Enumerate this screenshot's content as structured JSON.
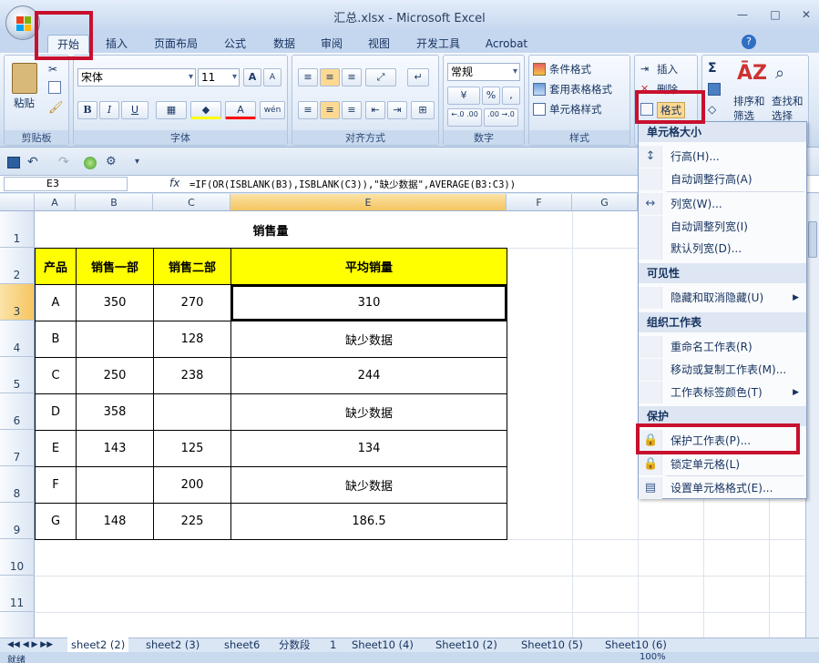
{
  "window": {
    "title": "汇总.xlsx - Microsoft Excel",
    "minimize": "—",
    "maximize": "□",
    "close": "✕"
  },
  "ribbon_tabs": [
    "开始",
    "插入",
    "页面布局",
    "公式",
    "数据",
    "审阅",
    "视图",
    "开发工具",
    "Acrobat"
  ],
  "ribbon": {
    "clipboard": {
      "paste": "粘贴",
      "label": "剪贴板"
    },
    "font": {
      "name": "宋体",
      "size": "11",
      "bold": "B",
      "italic": "I",
      "underline": "U",
      "grow": "A",
      "shrink": "A",
      "font_color": "A",
      "phonetic": "wén",
      "label": "字体"
    },
    "alignment": {
      "label": "对齐方式"
    },
    "number": {
      "format": "常规",
      "percent": "%",
      "comma": ",",
      "inc_dec": "←.0 .00",
      "dec_dec": ".00 →.0",
      "label": "数字"
    },
    "styles": {
      "conditional": "条件格式",
      "table": "套用表格格式",
      "cell": "单元格样式",
      "label": "样式"
    },
    "cells": {
      "insert": "插入",
      "delete": "删除",
      "format": "格式"
    },
    "editing": {
      "sum": "Σ",
      "sort": "排序和",
      "find": "查找和",
      "filter": "筛选",
      "select": "选择"
    }
  },
  "name_box": "E3",
  "formula": "=IF(OR(ISBLANK(B3),ISBLANK(C3)),\"缺少数据\",AVERAGE(B3:C3))",
  "fx": "fx",
  "columns": [
    "A",
    "B",
    "C",
    "E",
    "F",
    "G"
  ],
  "rows": [
    "1",
    "2",
    "3",
    "4",
    "5",
    "6",
    "7",
    "8",
    "9",
    "10",
    "11"
  ],
  "table": {
    "title": "销售量",
    "headers": [
      "产品",
      "销售一部",
      "销售二部",
      "平均销量"
    ],
    "rows": [
      [
        "A",
        "350",
        "270",
        "310"
      ],
      [
        "B",
        "",
        "128",
        "缺少数据"
      ],
      [
        "C",
        "250",
        "238",
        "244"
      ],
      [
        "D",
        "358",
        "",
        "缺少数据"
      ],
      [
        "E",
        "143",
        "125",
        "134"
      ],
      [
        "F",
        "",
        "200",
        "缺少数据"
      ],
      [
        "G",
        "148",
        "225",
        "186.5"
      ]
    ]
  },
  "sheet_tabs": [
    "sheet2 (2)",
    "sheet2 (3)",
    "sheet6",
    "分数段",
    "1",
    "Sheet10 (4)",
    "Sheet10 (2)",
    "Sheet10 (5)",
    "Sheet10 (6)"
  ],
  "status": {
    "ready": "就绪",
    "zoom": "100%"
  },
  "menu": {
    "sections": [
      {
        "title": "单元格大小",
        "items": [
          {
            "label": "行高(H)...",
            "icon": "row-height-icon"
          },
          {
            "label": "自动调整行高(A)"
          },
          {
            "label": "列宽(W)...",
            "icon": "column-width-icon"
          },
          {
            "label": "自动调整列宽(I)"
          },
          {
            "label": "默认列宽(D)..."
          }
        ]
      },
      {
        "title": "可见性",
        "items": [
          {
            "label": "隐藏和取消隐藏(U)",
            "submenu": true
          }
        ]
      },
      {
        "title": "组织工作表",
        "items": [
          {
            "label": "重命名工作表(R)"
          },
          {
            "label": "移动或复制工作表(M)..."
          },
          {
            "label": "工作表标签颜色(T)",
            "submenu": true
          }
        ]
      },
      {
        "title": "保护",
        "items": [
          {
            "label": "保护工作表(P)...",
            "icon": "lock-icon"
          },
          {
            "label": "锁定单元格(L)",
            "icon": "lock-icon"
          },
          {
            "label": "设置单元格格式(E)...",
            "icon": "format-cells-icon"
          }
        ]
      }
    ]
  },
  "colors": {
    "highlight": "#c8102e",
    "header_fill": "#ffff00",
    "ribbon_bg": "#dfe9f5"
  }
}
